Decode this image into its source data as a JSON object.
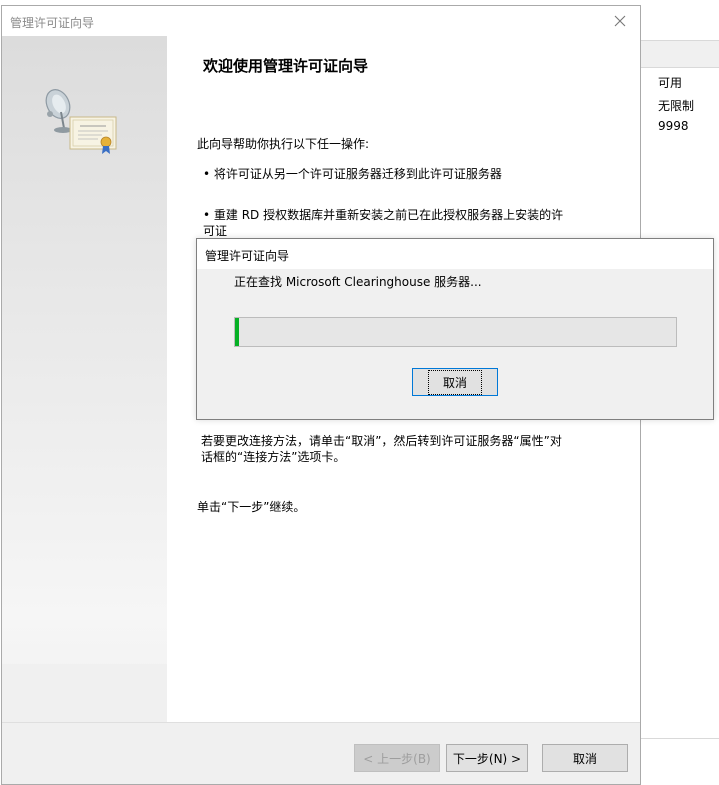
{
  "background_window": {
    "column_header": "可用",
    "rows": [
      "无限制",
      "9998"
    ]
  },
  "wizard": {
    "title": "管理许可证向导",
    "heading": "欢迎使用管理许可证向导",
    "intro": "此向导帮助你执行以下任一操作:",
    "bullets": [
      "• 将许可证从另一个许可证服务器迁移到此许可证服务器",
      "• 重建 RD 授权数据库并重新安装之前已在此授权服务器上安装的许可证"
    ],
    "connection_note": "若要更改连接方法，请单击“取消”，然后转到许可证服务器“属性”对话框的“连接方法”选项卡。",
    "continue_note": "单击“下一步”继续。",
    "buttons": {
      "back": "< 上一步(B)",
      "next": "下一步(N) >",
      "cancel": "取消"
    }
  },
  "progress_dialog": {
    "title": "管理许可证向导",
    "status": "正在查找 Microsoft Clearinghouse 服务器...",
    "progress": 0.01,
    "cancel": "取消"
  },
  "colors": {
    "progress_fill": "#06b025",
    "focus_border": "#0078d7"
  }
}
